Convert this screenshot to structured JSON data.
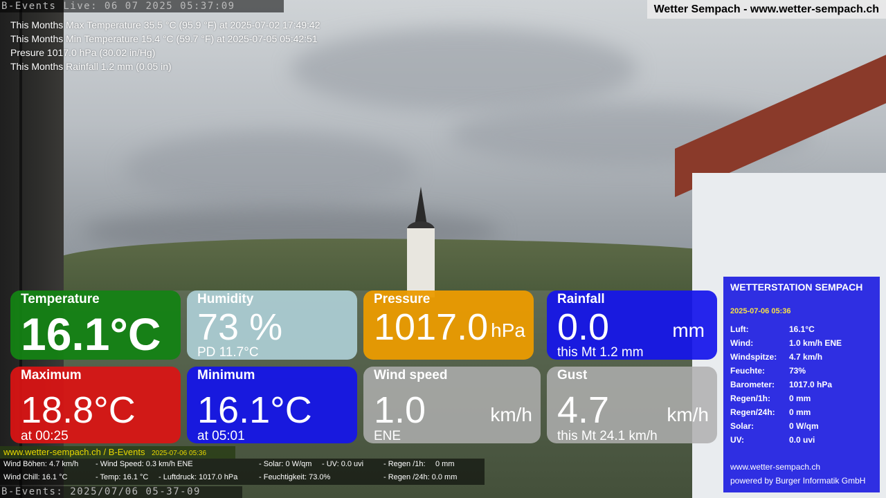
{
  "top_bar": {
    "text": "B-Events Live: 06 07 2025 05:37:09"
  },
  "site_title": "Wetter Sempach - www.wetter-sempach.ch",
  "stats": [
    "This Months Max Temperature 35.5 °C (95.9 °F) at 2025-07-02 17:49:42",
    "This Months Min Temperature 15.4 °C (59.7 °F) at 2025-07-05 05:42:51",
    "Presure 1017.0 hPa (30.02 in/Hg)",
    "This Months Rainfall 1.2 mm (0.05 in)"
  ],
  "tiles": {
    "temperature": {
      "title": "Temperature",
      "value": "16.1°C"
    },
    "humidity": {
      "title": "Humidity",
      "value": "73 %",
      "sub": "PD 11.7°C"
    },
    "pressure": {
      "title": "Pressure",
      "value": "1017.0",
      "unit": "hPa"
    },
    "rainfall": {
      "title": "Rainfall",
      "value": "0.0",
      "unit": "mm",
      "sub": "this Mt 1.2 mm"
    },
    "maximum": {
      "title": "Maximum",
      "value": "18.8°C",
      "sub": "at 00:25"
    },
    "minimum": {
      "title": "Minimum",
      "value": "16.1°C",
      "sub": "at 05:01"
    },
    "wind_speed": {
      "title": "Wind speed",
      "value": "1.0",
      "unit": "km/h",
      "sub": "ENE"
    },
    "gust": {
      "title": "Gust",
      "value": "4.7",
      "unit": "km/h",
      "sub": "this Mt 24.1 km/h"
    }
  },
  "footer": {
    "site": "www.wetter-sempach.ch / B-Events",
    "date": "2025-07-06 05:36",
    "row1": {
      "a": "Wind Böhen: 4.7 km/h",
      "b": "- Wind Speed: 0.3 km/h ENE",
      "c": "- Solar: 0 W/qm",
      "d": "- UV: 0.0 uvi",
      "e": "- Regen /1h:",
      "f": "0 mm"
    },
    "row2": {
      "a": "Wind Chill: 16.1 °C",
      "b": "- Temp: 16.1 °C",
      "c": "- Luftdruck: 1017.0 hPa",
      "d": "- Feuchtigkeit: 73.0%",
      "e": "- Regen /24h: 0.0 mm"
    }
  },
  "bottom_bar": {
    "text": "B-Events: 2025/07/06 05-37-09"
  },
  "panel": {
    "title": "WETTERSTATION SEMPACH",
    "date": "2025-07-06 05:36",
    "rows": [
      {
        "key": "Luft:",
        "value": "16.1°C"
      },
      {
        "key": "Wind:",
        "value": "1.0 km/h  ENE"
      },
      {
        "key": "Windspitze:",
        "value": "4.7 km/h"
      },
      {
        "key": "Feuchte:",
        "value": "73%"
      },
      {
        "key": "Barometer:",
        "value": "1017.0 hPa"
      },
      {
        "key": "Regen/1h:",
        "value": "0 mm"
      },
      {
        "key": "Regen/24h:",
        "value": "0 mm"
      },
      {
        "key": "Solar:",
        "value": "0 W/qm"
      },
      {
        "key": "UV:",
        "value": "0.0 uvi"
      }
    ],
    "footer_site": "www.wetter-sempach.ch",
    "footer_powered": "powered by Burger Informatik GmbH"
  }
}
